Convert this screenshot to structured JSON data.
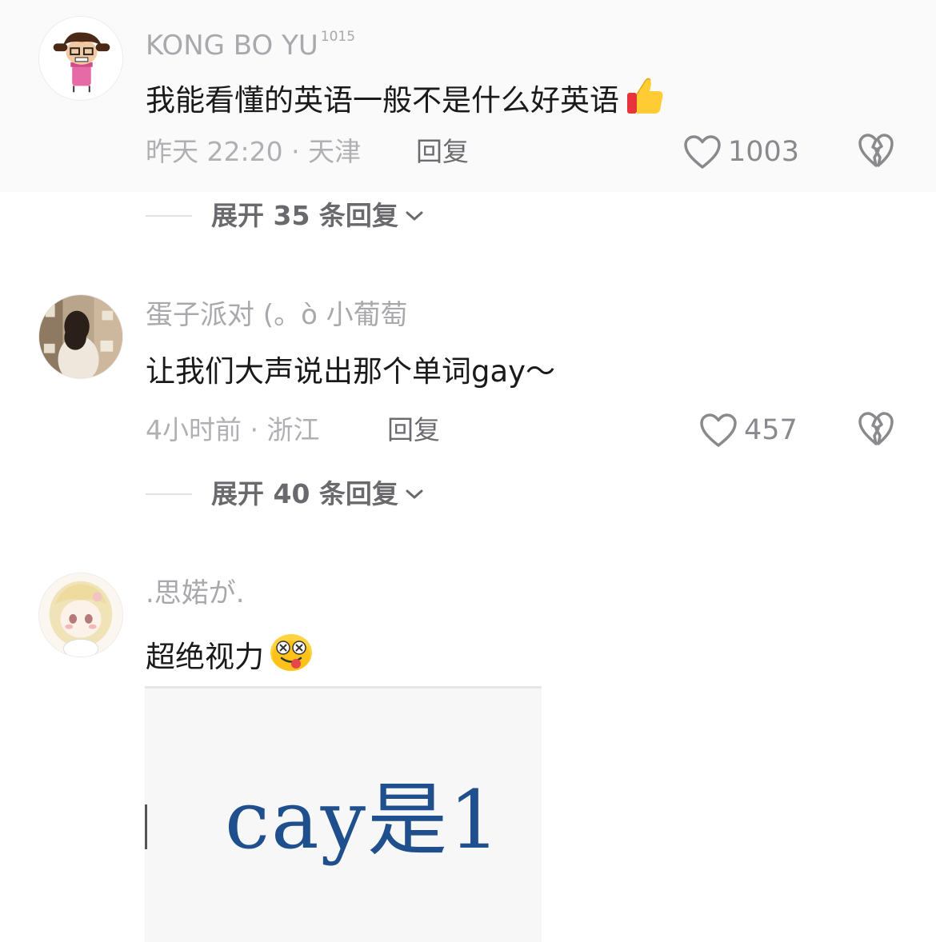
{
  "comments": [
    {
      "username": "KONG BO YU",
      "badge": "1015",
      "content": "我能看懂的英语一般不是什么好英语",
      "content_emoji": "thumbs-up",
      "time": "昨天 22:20",
      "location": "天津",
      "meta_separator": " · ",
      "reply_label": "回复",
      "likes": "1003",
      "expand_label": "展开 35 条回复"
    },
    {
      "username": "蛋子派对 (。ò 小葡萄",
      "content": "让我们大声说出那个单词gay～",
      "time": "4小时前",
      "location": "浙江",
      "meta_separator": " · ",
      "reply_label": "回复",
      "likes": "457",
      "expand_label": "展开 40 条回复"
    },
    {
      "username": ".思婼が.",
      "content": "超绝视力",
      "content_emoji": "dizzy-tongue-face",
      "attached_image_text": "cay是1"
    }
  ],
  "icons": {
    "like": "heart-outline-icon",
    "dislike": "broken-heart-icon",
    "expand": "chevron-down-icon"
  },
  "colors": {
    "text_primary": "#1a1a1a",
    "text_secondary": "#a9a9ad",
    "reply": "#6c6c70",
    "image_text": "#1f4f8c"
  }
}
